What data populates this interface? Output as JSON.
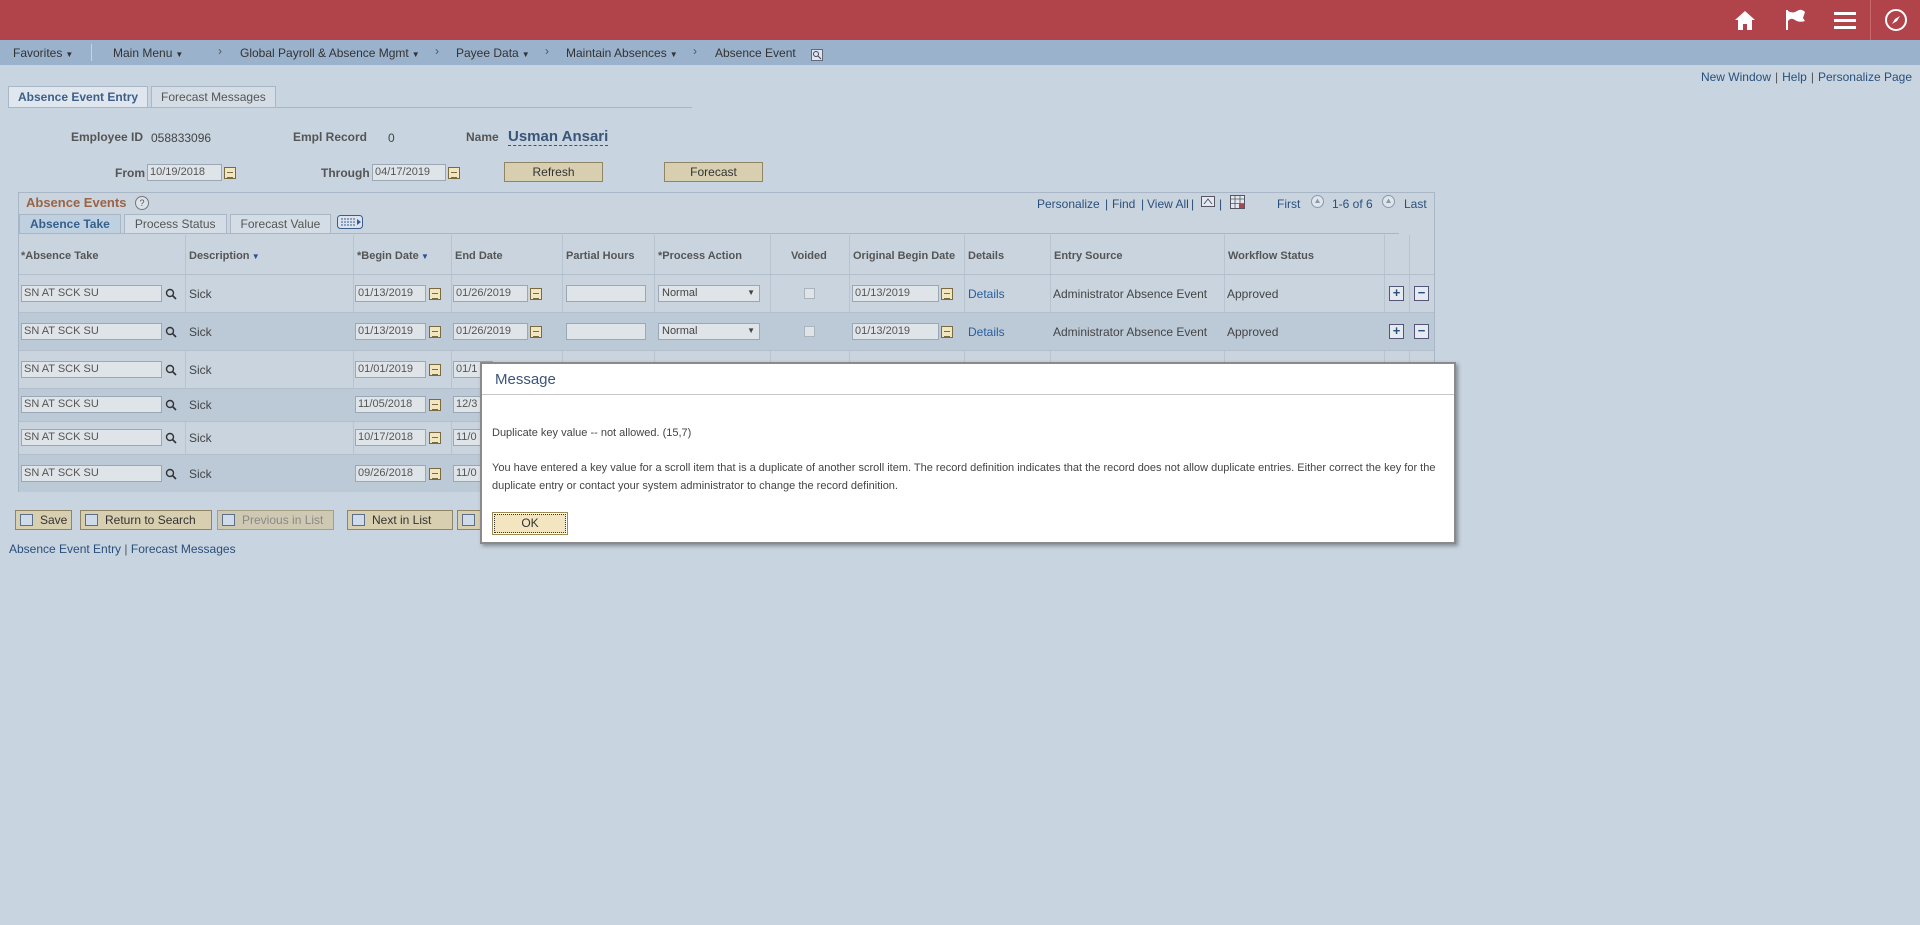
{
  "nav": {
    "favorites": "Favorites",
    "main_menu": "Main Menu",
    "crumb1": "Global Payroll & Absence Mgmt",
    "crumb2": "Payee Data",
    "crumb3": "Maintain Absences",
    "crumb4": "Absence Event",
    "sep": "›"
  },
  "banner_icons": [
    "home-icon",
    "flag-icon",
    "menu-icon",
    "navbar-compass-icon"
  ],
  "top_links": {
    "new_window": "New Window",
    "help": "Help",
    "personalize_page": "Personalize Page",
    "sep": "|"
  },
  "page_tabs": [
    "Absence Event Entry",
    "Forecast Messages"
  ],
  "header": {
    "employee_id_label": "Employee ID",
    "employee_id": "058833096",
    "empl_record_label": "Empl Record",
    "empl_record": "0",
    "name_label": "Name",
    "name": "Usman Ansari",
    "from_label": "From",
    "from": "10/19/2018",
    "through_label": "Through",
    "through": "04/17/2019",
    "refresh": "Refresh",
    "forecast": "Forecast"
  },
  "grid": {
    "title": "Absence Events",
    "help": "?",
    "personalize": "Personalize",
    "find": "Find",
    "view_all": "View All",
    "sep": "|",
    "first": "First",
    "range": "1-6 of 6",
    "last": "Last",
    "tabs": [
      "Absence Take",
      "Process Status",
      "Forecast Value"
    ],
    "columns": [
      "*Absence Take",
      "Description",
      "*Begin Date",
      "End Date",
      "Partial Hours",
      "*Process Action",
      "Voided",
      "Original Begin Date",
      "Details",
      "Entry Source",
      "Workflow Status"
    ],
    "rows": [
      {
        "take": "SN AT SCK SU",
        "desc": "Sick",
        "begin": "01/13/2019",
        "end": "01/26/2019",
        "action": "Normal",
        "orig": "01/13/2019",
        "details": "Details",
        "source": "Administrator Absence Event",
        "status": "Approved"
      },
      {
        "take": "SN AT SCK SU",
        "desc": "Sick",
        "begin": "01/13/2019",
        "end": "01/26/2019",
        "action": "Normal",
        "orig": "01/13/2019",
        "details": "Details",
        "source": "Administrator Absence Event",
        "status": "Approved"
      },
      {
        "take": "SN AT SCK SU",
        "desc": "Sick",
        "begin": "01/01/2019",
        "end": "01/1"
      },
      {
        "take": "SN AT SCK SU",
        "desc": "Sick",
        "begin": "11/05/2018",
        "end": "12/3"
      },
      {
        "take": "SN AT SCK SU",
        "desc": "Sick",
        "begin": "10/17/2018",
        "end": "11/0"
      },
      {
        "take": "SN AT SCK SU",
        "desc": "Sick",
        "begin": "09/26/2018",
        "end": "11/0"
      }
    ]
  },
  "toolbar": {
    "save": "Save",
    "return": "Return to Search",
    "prev": "Previous in List",
    "next": "Next in List"
  },
  "bottom_links": {
    "entry": "Absence Event Entry",
    "sep": "|",
    "messages": "Forecast Messages"
  },
  "modal": {
    "title": "Message",
    "line1": "Duplicate key value -- not allowed. (15,7)",
    "line2": "You have entered a key value for a scroll item that is a duplicate of another scroll item. The record definition indicates that the record does not allow duplicate entries.  Either correct the key for the duplicate entry or contact your system administrator to change the record definition.",
    "ok": "OK"
  },
  "colors": {
    "banner": "#b0444a",
    "navbar": "#9bb2cc",
    "page_bg": "#c8d4df",
    "link": "#2a5d9a"
  }
}
